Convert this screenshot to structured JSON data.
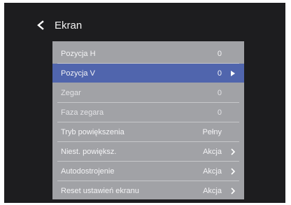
{
  "header": {
    "title": "Ekran",
    "back_icon": "chevron-left-icon"
  },
  "menu": {
    "items": [
      {
        "label": "Pozycja H",
        "value": "0",
        "icon": ""
      },
      {
        "label": "Pozycja V",
        "value": "0",
        "icon": "play-arrow-icon"
      },
      {
        "label": "Zegar",
        "value": "0",
        "icon": ""
      },
      {
        "label": "Faza zegara",
        "value": "0",
        "icon": ""
      },
      {
        "label": "Tryb powiększenia",
        "value": "Pełny",
        "icon": ""
      },
      {
        "label": "Niest. powiększ.",
        "value": "Akcja",
        "icon": "chevron-right-icon"
      },
      {
        "label": "Autodostrojenie",
        "value": "Akcja",
        "icon": "chevron-right-icon"
      },
      {
        "label": "Reset ustawień ekranu",
        "value": "Akcja",
        "icon": "chevron-right-icon"
      }
    ],
    "selected_index": 1
  },
  "colors": {
    "background": "#1d1d1f",
    "panel": "#a1a2a6",
    "selection": "#5065ad",
    "text": "#f4f4f6"
  }
}
